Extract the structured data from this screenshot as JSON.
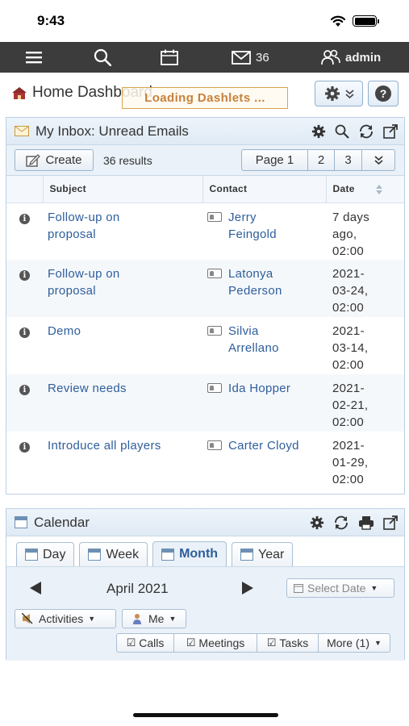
{
  "status": {
    "time": "9:43"
  },
  "nav": {
    "mail_count": "36",
    "user": "admin"
  },
  "header": {
    "title": "Home Dashboard",
    "loading": "Loading Dashlets ..."
  },
  "inbox": {
    "title": "My Inbox: Unread Emails",
    "create_label": "Create",
    "results": "36 results",
    "pages": [
      "Page 1",
      "2",
      "3"
    ],
    "columns": {
      "subject": "Subject",
      "contact": "Contact",
      "date": "Date"
    },
    "rows": [
      {
        "subject": [
          "Follow-up on",
          "proposal"
        ],
        "contact": [
          "Jerry",
          "Feingold"
        ],
        "date": [
          "7 days",
          "ago,",
          "02:00"
        ]
      },
      {
        "subject": [
          "Follow-up on",
          "proposal"
        ],
        "contact": [
          "Latonya",
          "Pederson"
        ],
        "date": [
          "2021-",
          "03-24,",
          "02:00"
        ]
      },
      {
        "subject": [
          "Demo"
        ],
        "contact": [
          "Silvia",
          "Arrellano"
        ],
        "date": [
          "2021-",
          "03-14,",
          "02:00"
        ]
      },
      {
        "subject": [
          "Review needs"
        ],
        "contact": [
          "Ida Hopper"
        ],
        "date": [
          "2021-",
          "02-21,",
          "02:00"
        ]
      },
      {
        "subject": [
          "Introduce all players"
        ],
        "contact": [
          "Carter Cloyd"
        ],
        "date": [
          "2021-",
          "01-29,",
          "02:00"
        ]
      }
    ]
  },
  "calendar": {
    "title": "Calendar",
    "tabs": [
      "Day",
      "Week",
      "Month",
      "Year"
    ],
    "active_tab": "Month",
    "month": "April 2021",
    "select_date": "Select Date",
    "activities": "Activities",
    "me": "Me",
    "filters": [
      "Calls",
      "Meetings",
      "Tasks"
    ],
    "more": "More (1)"
  },
  "colors": {
    "nav_bg": "#3c3c3c",
    "link": "#2e5e9c",
    "loading": "#c8803a"
  }
}
